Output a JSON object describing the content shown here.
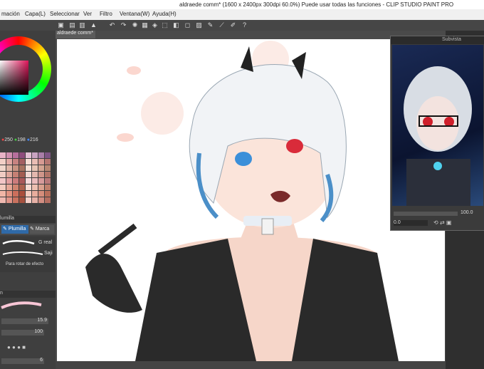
{
  "window": {
    "title": "aldraede comm* (1600 x 2400px 300dpi 60.0%)  Puede usar todas las funciones - CLIP STUDIO PAINT PRO"
  },
  "menu": [
    "mación",
    "Capa(L)",
    "Seleccionar",
    "Ver",
    "Filtro",
    "Ventana(W)",
    "Ayuda(H)"
  ],
  "canvas_tab": "aldraede comm*",
  "color_panel": {
    "r": "250",
    "g": "198",
    "b": "216",
    "current_color": "#f8c6d6"
  },
  "brush_panel": {
    "tabs": [
      "Plumilla",
      "Marca"
    ],
    "tab_header": "lumilla",
    "brushes": [
      "G real",
      "Saji",
      "Para rotar de efecto"
    ],
    "size_header": "n",
    "size_value": "15.9",
    "opacity_value": "100",
    "extra_value": "6"
  },
  "subvista": {
    "title": "Subvista",
    "zoom": "100.0",
    "angle": "0.0"
  },
  "colors": {
    "accent": "#3b8fd9",
    "palette_bg": "#3f3f3f"
  }
}
